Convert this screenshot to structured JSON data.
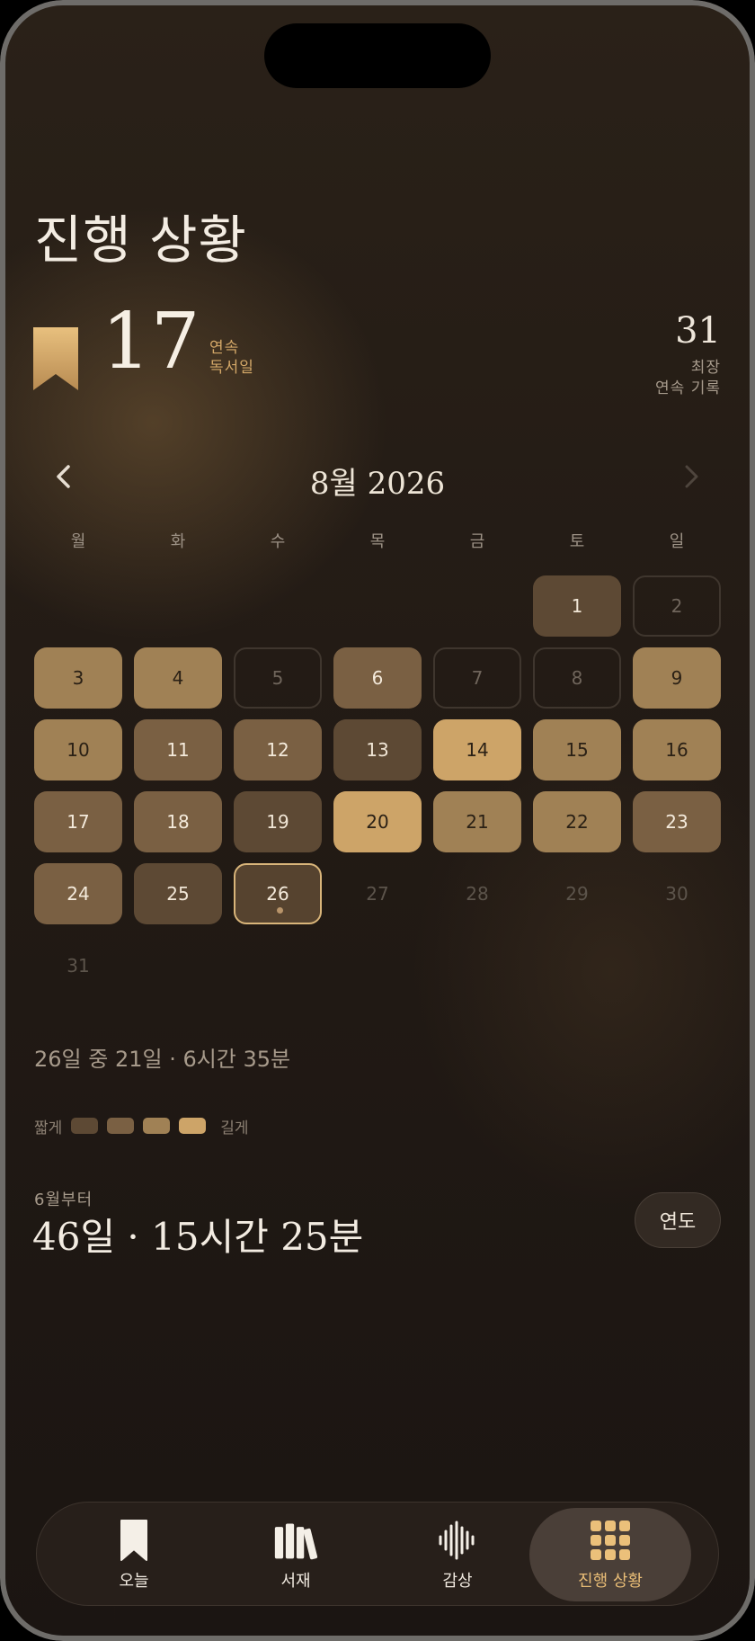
{
  "page_title": "진행 상황",
  "streak": {
    "current": "17",
    "current_label_line1": "연속",
    "current_label_line2": "독서일",
    "best": "31",
    "best_label_line1": "최장",
    "best_label_line2": "연속 기록",
    "icon": "bookmark-icon"
  },
  "calendar": {
    "month_label": "8월 2026",
    "weekdays": [
      "월",
      "화",
      "수",
      "목",
      "금",
      "토",
      "일"
    ],
    "today": 26,
    "days": [
      {
        "day": "1",
        "level": 1
      },
      {
        "day": "2",
        "level": 0
      },
      {
        "day": "3",
        "level": 3
      },
      {
        "day": "4",
        "level": 3
      },
      {
        "day": "5",
        "level": 0
      },
      {
        "day": "6",
        "level": 2
      },
      {
        "day": "7",
        "level": 0
      },
      {
        "day": "8",
        "level": 0
      },
      {
        "day": "9",
        "level": 3
      },
      {
        "day": "10",
        "level": 3
      },
      {
        "day": "11",
        "level": 2
      },
      {
        "day": "12",
        "level": 2
      },
      {
        "day": "13",
        "level": 1
      },
      {
        "day": "14",
        "level": 4
      },
      {
        "day": "15",
        "level": 3
      },
      {
        "day": "16",
        "level": 3
      },
      {
        "day": "17",
        "level": 2
      },
      {
        "day": "18",
        "level": 2
      },
      {
        "day": "19",
        "level": 1
      },
      {
        "day": "20",
        "level": 4
      },
      {
        "day": "21",
        "level": 3
      },
      {
        "day": "22",
        "level": 3
      },
      {
        "day": "23",
        "level": 2
      },
      {
        "day": "24",
        "level": 2
      },
      {
        "day": "25",
        "level": 1
      },
      {
        "day": "26",
        "level": "today"
      },
      {
        "day": "27",
        "level": "future"
      },
      {
        "day": "28",
        "level": "future"
      },
      {
        "day": "29",
        "level": "future"
      },
      {
        "day": "30",
        "level": "future"
      },
      {
        "day": "31",
        "level": "future"
      }
    ]
  },
  "summary": "26일 중 21일 · 6시간 35분",
  "legend": {
    "short_label": "짧게",
    "long_label": "길게",
    "colors": [
      "#5d4934",
      "#7a6043",
      "#a08155",
      "#cda468"
    ]
  },
  "totals": {
    "since_label": "6월부터",
    "value": "46일 · 15시간 25분",
    "year_button": "연도"
  },
  "tabs": [
    {
      "label": "오늘",
      "icon": "bookmark-icon"
    },
    {
      "label": "서재",
      "icon": "library-icon"
    },
    {
      "label": "감상",
      "icon": "waveform-icon"
    },
    {
      "label": "진행 상황",
      "icon": "grid-icon",
      "active": true
    }
  ],
  "colors": {
    "accent": "#e9bd76",
    "background": "#231b15"
  }
}
